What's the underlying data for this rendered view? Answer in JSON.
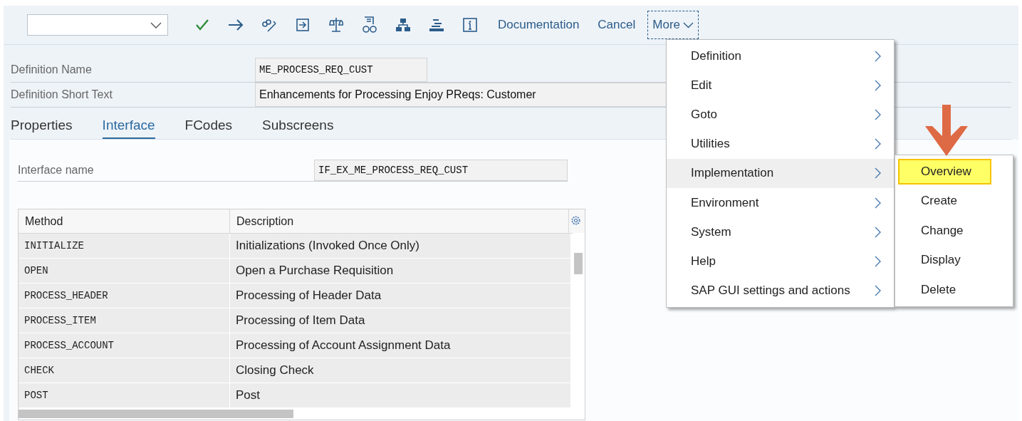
{
  "toolbar": {
    "buttons": [
      {
        "label": "Documentation"
      },
      {
        "label": "Cancel"
      }
    ],
    "more": {
      "label": "More",
      "expanded": true
    }
  },
  "fields": [
    {
      "label": "Definition Name",
      "value": "ME_PROCESS_REQ_CUST",
      "kind": "mono"
    },
    {
      "label": "Definition Short Text",
      "value": "Enhancements for Processing Enjoy PReqs: Customer",
      "kind": "text"
    }
  ],
  "tabs": [
    {
      "label": "Properties",
      "selected": false
    },
    {
      "label": "Interface",
      "selected": true
    },
    {
      "label": "FCodes",
      "selected": false
    },
    {
      "label": "Subscreens",
      "selected": false
    }
  ],
  "interface_name": {
    "label": "Interface name",
    "value": "IF_EX_ME_PROCESS_REQ_CUST"
  },
  "table": {
    "columns": [
      "Method",
      "Description"
    ],
    "rows": [
      {
        "method": "INITIALIZE",
        "description": "Initializations (Invoked Once Only)"
      },
      {
        "method": "OPEN",
        "description": "Open a Purchase Requisition"
      },
      {
        "method": "PROCESS_HEADER",
        "description": "Processing of Header Data"
      },
      {
        "method": "PROCESS_ITEM",
        "description": "Processing of Item Data"
      },
      {
        "method": "PROCESS_ACCOUNT",
        "description": "Processing of Account Assignment Data"
      },
      {
        "method": "CHECK",
        "description": "Closing Check"
      },
      {
        "method": "POST",
        "description": "Post"
      }
    ]
  },
  "menu": {
    "items": [
      {
        "label": "Definition",
        "selected": false
      },
      {
        "label": "Edit",
        "selected": false
      },
      {
        "label": "Goto",
        "selected": false
      },
      {
        "label": "Utilities",
        "selected": false
      },
      {
        "label": "Implementation",
        "selected": true
      },
      {
        "label": "Environment",
        "selected": false
      },
      {
        "label": "System",
        "selected": false
      },
      {
        "label": "Help",
        "selected": false
      },
      {
        "label": "SAP GUI settings and actions",
        "selected": false
      }
    ],
    "submenu": [
      {
        "label": "Overview",
        "selected": true
      },
      {
        "label": "Create",
        "selected": false
      },
      {
        "label": "Change",
        "selected": false
      },
      {
        "label": "Display",
        "selected": false
      },
      {
        "label": "Delete",
        "selected": false
      }
    ]
  }
}
